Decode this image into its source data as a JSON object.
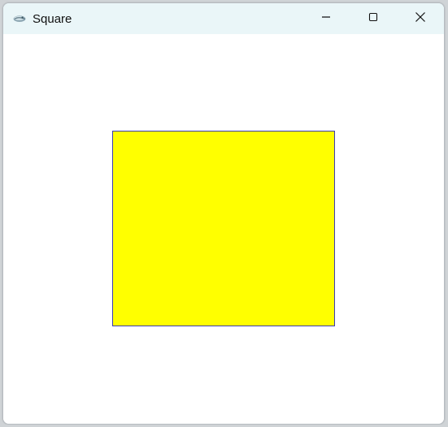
{
  "window": {
    "title": "Square"
  },
  "icons": {
    "app": "app-icon",
    "minimize": "minimize-icon",
    "maximize": "maximize-icon",
    "close": "close-icon"
  },
  "canvas": {
    "shape": "square",
    "fill_color": "#ffff00",
    "stroke_color": "#3b3bb3"
  }
}
